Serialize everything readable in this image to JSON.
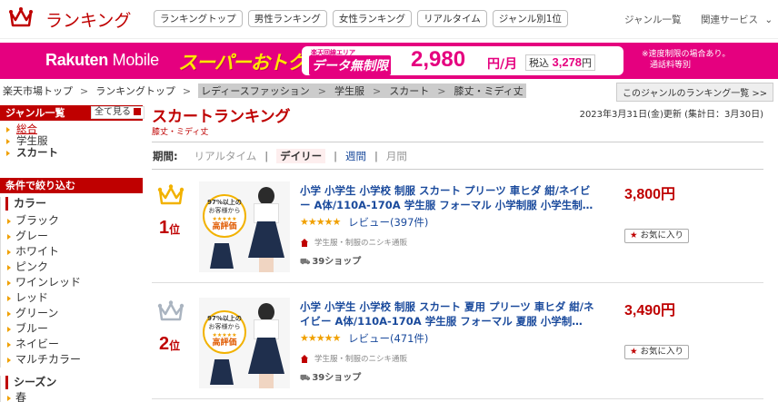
{
  "header": {
    "logo_text": "ランキング",
    "tabs": [
      "ランキングトップ",
      "男性ランキング",
      "女性ランキング",
      "リアルタイム",
      "ジャンル別1位"
    ],
    "genre_list": "ジャンル一覧",
    "related": "関連サービス",
    "related_icon": "chevron-down-icon"
  },
  "banner": {
    "logo_bold": "Rakuten",
    "logo_rest": " Mobile",
    "headline": "スーパーおトク",
    "area_note": "楽天回線エリア",
    "unlimited": "データ無制限",
    "price": "2,980",
    "unit": "円/月",
    "tax_label": "税込",
    "tax_price": "3,278",
    "tax_unit": "円",
    "note_line1": "※速度制限の場合あり。",
    "note_line2": "通話料等別",
    "brand_color": "#e5007f"
  },
  "breadcrumb": {
    "items": [
      "楽天市場トップ",
      "ランキングトップ"
    ],
    "highlighted": [
      "レディースファッション",
      "学生服",
      "スカート",
      "膝丈・ミディ丈"
    ],
    "separator": ">",
    "genre_more": "このジャンルのランキング一覧 >>"
  },
  "sidebar": {
    "genre_header": "ジャンル一覧",
    "all_button": "全て見る",
    "genres": [
      "総合",
      "学生服",
      "スカート"
    ],
    "filter_header": "条件で絞り込む",
    "color_header": "カラー",
    "colors": [
      "ブラック",
      "グレー",
      "ホワイト",
      "ピンク",
      "ワインレッド",
      "レッド",
      "グリーン",
      "ブルー",
      "ネイビー",
      "マルチカラー"
    ],
    "season_header": "シーズン",
    "seasons": [
      "春"
    ]
  },
  "main": {
    "title": "スカートランキング",
    "subtitle": "膝丈・ミディ丈",
    "updated": "2023年3月31日(金)更新 (集計日：3月30日)",
    "period_label": "期間:",
    "periods": [
      "リアルタイム",
      "デイリー",
      "週間",
      "月間"
    ],
    "active_period": "デイリー"
  },
  "items": [
    {
      "rank": "1",
      "rank_suffix": "位",
      "crown_color": "#f2b200",
      "badge_pct": "97%以上の",
      "badge_line": "お客様から",
      "badge_stars": "★★★★★",
      "badge_main": "高評価",
      "title": "小学 小学生 小学校 制服 スカート プリーツ 車ヒダ 紺/ネイビー A体/110A-170A 学生服 フォーマル 小学制服 小学生制…",
      "stars": "★★★★★",
      "review": "レビュー(397件)",
      "shop": "学生服・制服のニシキ通販",
      "ship": "39ショップ",
      "price": "3,800円",
      "fav": "お気に入り"
    },
    {
      "rank": "2",
      "rank_suffix": "位",
      "crown_color": "#aab4c0",
      "badge_pct": "97%以上の",
      "badge_line": "お客様から",
      "badge_stars": "★★★★★",
      "badge_main": "高評価",
      "title": "小学 小学生 小学校 制服 スカート 夏用 プリーツ 車ヒダ 紺/ネイビー A体/110A-170A 学生服 フォーマル 夏服 小学制…",
      "stars": "★★★★★",
      "review": "レビュー(471件)",
      "shop": "学生服・制服のニシキ通販",
      "ship": "39ショップ",
      "price": "3,490円",
      "fav": "お気に入り"
    }
  ]
}
